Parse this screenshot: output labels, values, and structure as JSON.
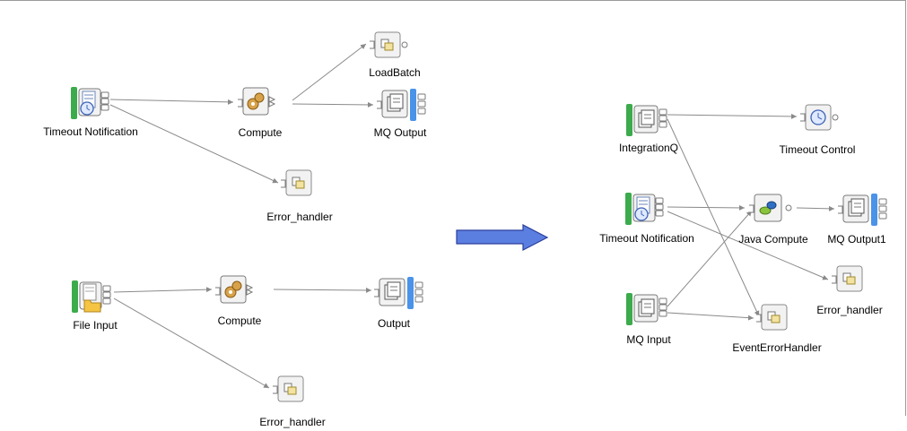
{
  "left_top_flow": {
    "timeout_notification": "Timeout Notification",
    "compute": "Compute",
    "load_batch": "LoadBatch",
    "mq_output": "MQ Output",
    "error_handler": "Error_handler"
  },
  "left_bottom_flow": {
    "file_input": "File Input",
    "compute": "Compute",
    "output": "Output",
    "error_handler": "Error_handler"
  },
  "right_flow": {
    "integration_q": "IntegrationQ",
    "timeout_control": "Timeout Control",
    "timeout_notification": "Timeout Notification",
    "java_compute": "Java Compute",
    "mq_output1": "MQ Output1",
    "error_handler": "Error_handler",
    "mq_input": "MQ Input",
    "event_error_handler": "EventErrorHandler"
  },
  "icons": [
    "timeout-notification-icon",
    "compute-icon",
    "subflow-icon",
    "mq-output-icon",
    "file-input-icon",
    "mq-input-icon",
    "timeout-control-icon",
    "java-compute-icon",
    "transform-arrow-icon"
  ],
  "colors": {
    "connection": "#8a8a8a",
    "arrow_fill": "#5b7fe0",
    "arrow_stroke": "#2c3f9c",
    "node_bg": "#f2f2f2",
    "queue_green": "#3cab4c",
    "queue_blue": "#4a93e8"
  }
}
